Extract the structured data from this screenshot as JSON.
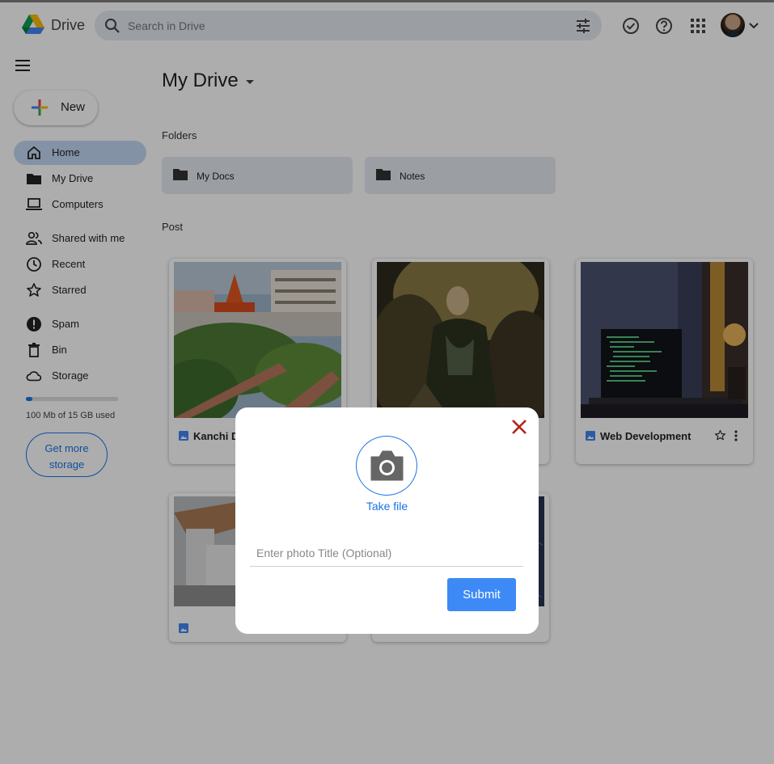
{
  "header": {
    "brand": "Drive",
    "search_placeholder": "Search in Drive"
  },
  "sidebar": {
    "new_label": "New",
    "items": [
      {
        "label": "Home",
        "icon": "home-icon",
        "active": true
      },
      {
        "label": "My Drive",
        "icon": "folder-icon"
      },
      {
        "label": "Computers",
        "icon": "laptop-icon"
      },
      {
        "label": "Shared with me",
        "icon": "people-icon"
      },
      {
        "label": "Recent",
        "icon": "clock-icon"
      },
      {
        "label": "Starred",
        "icon": "star-icon"
      },
      {
        "label": "Spam",
        "icon": "alert-icon"
      },
      {
        "label": "Bin",
        "icon": "trash-icon"
      },
      {
        "label": "Storage",
        "icon": "cloud-icon"
      }
    ],
    "storage": {
      "used_fraction": 0.07,
      "text": "100 Mb of 15 GB used",
      "button_line1": "Get more",
      "button_line2": "storage"
    }
  },
  "main": {
    "title": "My Drive",
    "folders_label": "Folders",
    "folders": [
      {
        "name": "My Docs"
      },
      {
        "name": "Notes"
      }
    ],
    "post_label": "Post",
    "posts": [
      {
        "title": "Kanchi Dham"
      },
      {
        "title": ""
      },
      {
        "title": "Web Development"
      },
      {
        "title": ""
      },
      {
        "title": ""
      }
    ]
  },
  "modal": {
    "take_file_label": "Take file",
    "title_placeholder": "Enter photo Title (Optional)",
    "submit_label": "Submit"
  },
  "colors": {
    "accent": "#1a73e8",
    "submit": "#3d8af7",
    "close": "#b3261e",
    "active_nav": "#c3d7f5"
  }
}
